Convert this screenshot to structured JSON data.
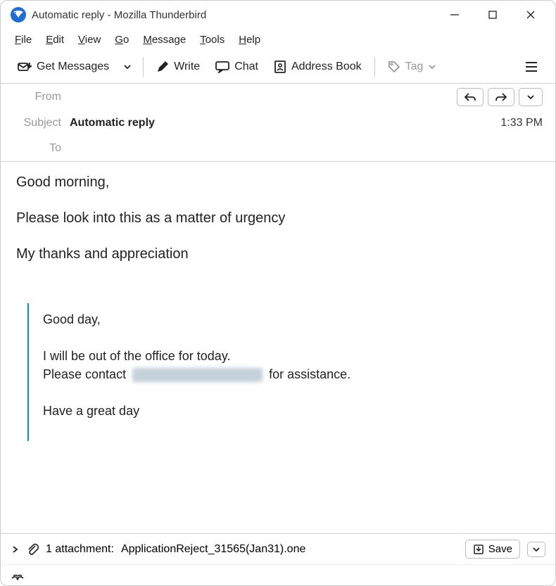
{
  "window": {
    "title": "Automatic reply - Mozilla Thunderbird"
  },
  "menu": {
    "file": "File",
    "edit": "Edit",
    "view": "View",
    "go": "Go",
    "message": "Message",
    "tools": "Tools",
    "help": "Help"
  },
  "toolbar": {
    "get_messages": "Get Messages",
    "write": "Write",
    "chat": "Chat",
    "address_book": "Address Book",
    "tag": "Tag"
  },
  "header": {
    "from_label": "From",
    "from_value": "",
    "subject_label": "Subject",
    "subject_value": "Automatic reply",
    "to_label": "To",
    "to_value": "",
    "time": "1:33 PM"
  },
  "body": {
    "line1": "Good morning,",
    "line2": "Please look into this as a matter of urgency",
    "line3": "My thanks and appreciation",
    "quoted": {
      "q1": "Good day,",
      "q2a": "I will be out of the office for today.",
      "q2b_prefix": "Please contact ",
      "q2b_suffix": " for assistance.",
      "q3": "Have a great day"
    }
  },
  "attachment": {
    "count_label": "1 attachment:",
    "filename": "ApplicationReject_31565(Jan31).one",
    "save_label": "Save"
  }
}
